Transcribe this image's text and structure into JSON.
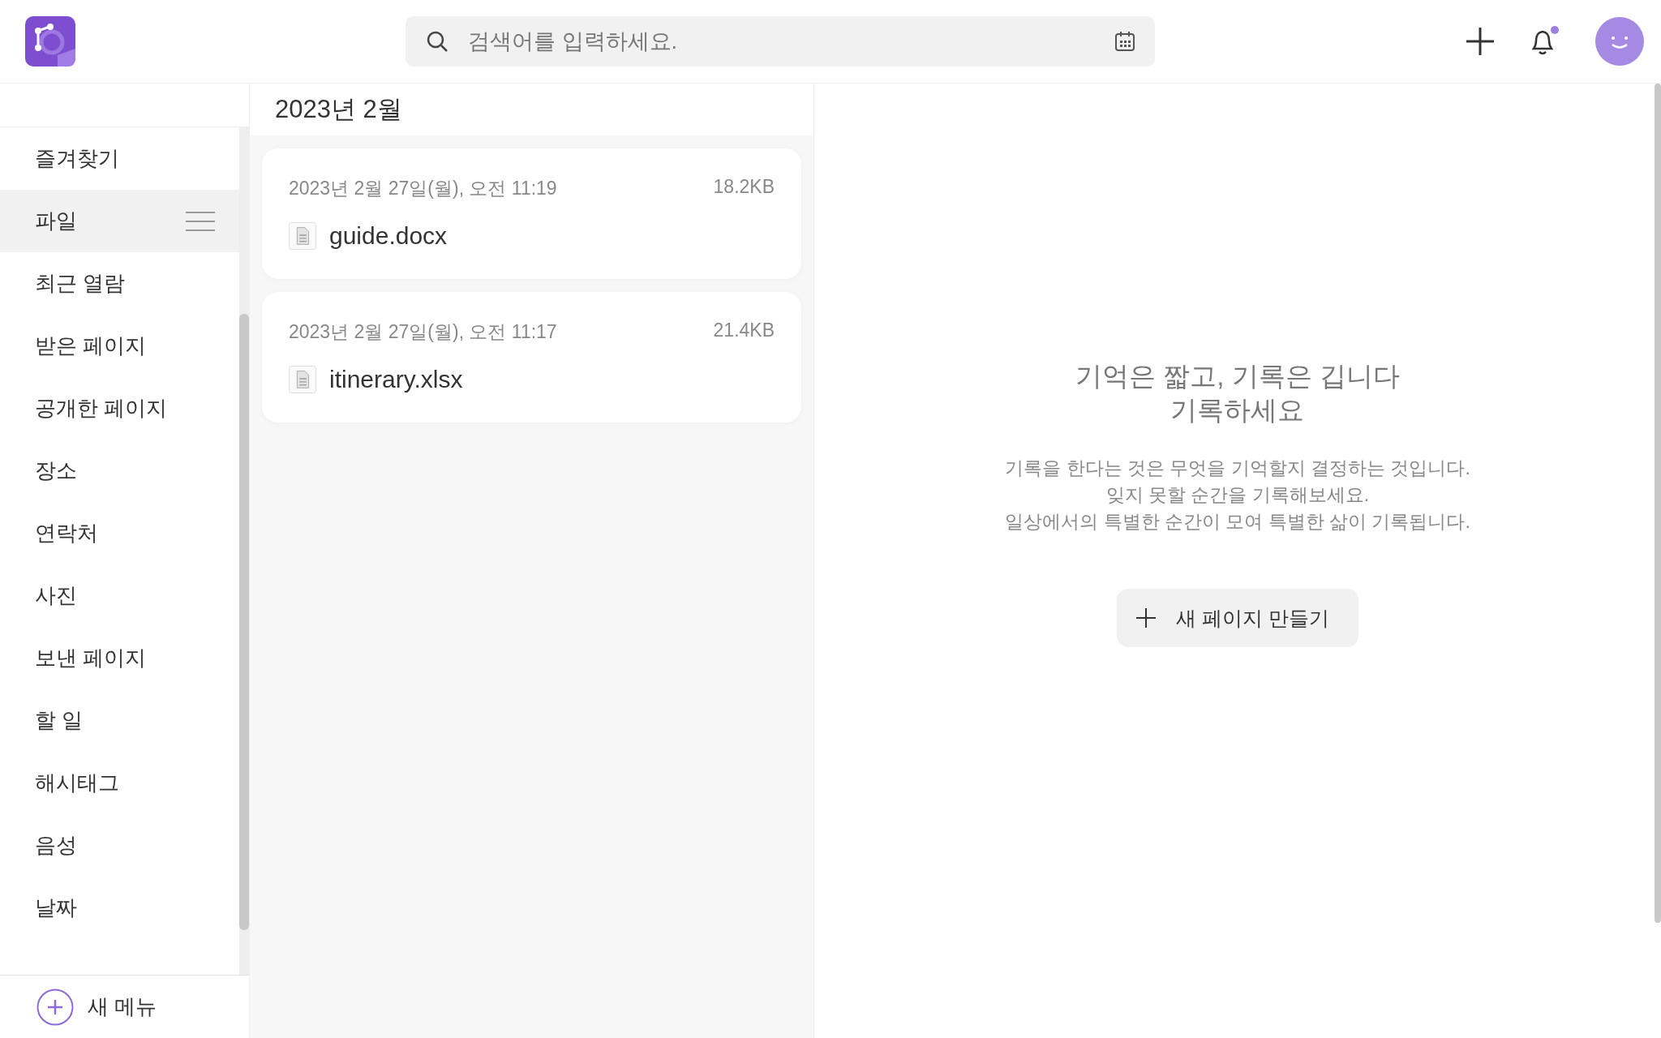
{
  "header": {
    "search": {
      "placeholder": "검색어를 입력하세요."
    },
    "notifications": {
      "unread": true
    }
  },
  "sidebar": {
    "items": [
      {
        "label": "즐겨찾기",
        "selected": false
      },
      {
        "label": "파일",
        "selected": true
      },
      {
        "label": "최근 열람",
        "selected": false
      },
      {
        "label": "받은 페이지",
        "selected": false
      },
      {
        "label": "공개한 페이지",
        "selected": false
      },
      {
        "label": "장소",
        "selected": false
      },
      {
        "label": "연락처",
        "selected": false
      },
      {
        "label": "사진",
        "selected": false
      },
      {
        "label": "보낸 페이지",
        "selected": false
      },
      {
        "label": "할 일",
        "selected": false
      },
      {
        "label": "해시태그",
        "selected": false
      },
      {
        "label": "음성",
        "selected": false
      },
      {
        "label": "날짜",
        "selected": false
      }
    ],
    "new_menu": "새 메뉴"
  },
  "file_list": {
    "heading": "2023년 2월",
    "files": [
      {
        "date": "2023년 2월 27일(월), 오전 11:19",
        "size": "18.2KB",
        "name": "guide.docx"
      },
      {
        "date": "2023년 2월 27일(월), 오전 11:17",
        "size": "21.4KB",
        "name": "itinerary.xlsx"
      }
    ]
  },
  "empty_state": {
    "title_lines": [
      "기억은 짧고, 기록은 깁니다",
      "기록하세요"
    ],
    "body_lines": [
      "기록을 한다는 것은 무엇을 기억할지 결정하는 것입니다.",
      "잊지 못할 순간을 기록해보세요.",
      "일상에서의 특별한 순간이 모여 특별한 삶이 기록됩니다."
    ],
    "button": "새 페이지 만들기"
  }
}
